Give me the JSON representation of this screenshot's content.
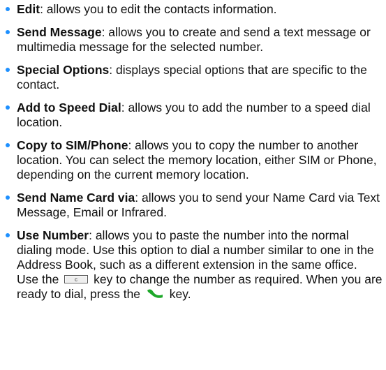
{
  "colors": {
    "bullet": "#1e90ff",
    "send_key": "#1ea82a",
    "clear_key_border": "#555555"
  },
  "icons": {
    "clear_key": "clear-key-icon",
    "send_key": "send-key-icon"
  },
  "items": [
    {
      "term": "Edit",
      "desc": ": allows you to edit the contacts information."
    },
    {
      "term": "Send Message",
      "desc": ": allows you to create and send a text message or multimedia message for the selected number."
    },
    {
      "term": "Special Options",
      "desc": ": displays special options that are specific to the contact."
    },
    {
      "term": "Add to Speed Dial",
      "desc": ": allows you to add the number to a speed dial location."
    },
    {
      "term": "Copy to SIM/Phone",
      "desc": ": allows you to copy the number to another location. You can select the memory location, either SIM or Phone, depending on the current memory location."
    },
    {
      "term": "Send Name Card via",
      "desc": ": allows you to send your Name Card via Text Message, Email or Infrared."
    },
    {
      "term": "Use Number",
      "desc": ": allows you to paste the number into the normal dialing mode. Use this option to dial a number similar to one in the Address Book, such as a different extension in the same office.",
      "note_before_clear": "Use the",
      "note_after_clear": "key to change the number as required. When you are ready to dial, press the",
      "note_after_send": "key."
    }
  ]
}
